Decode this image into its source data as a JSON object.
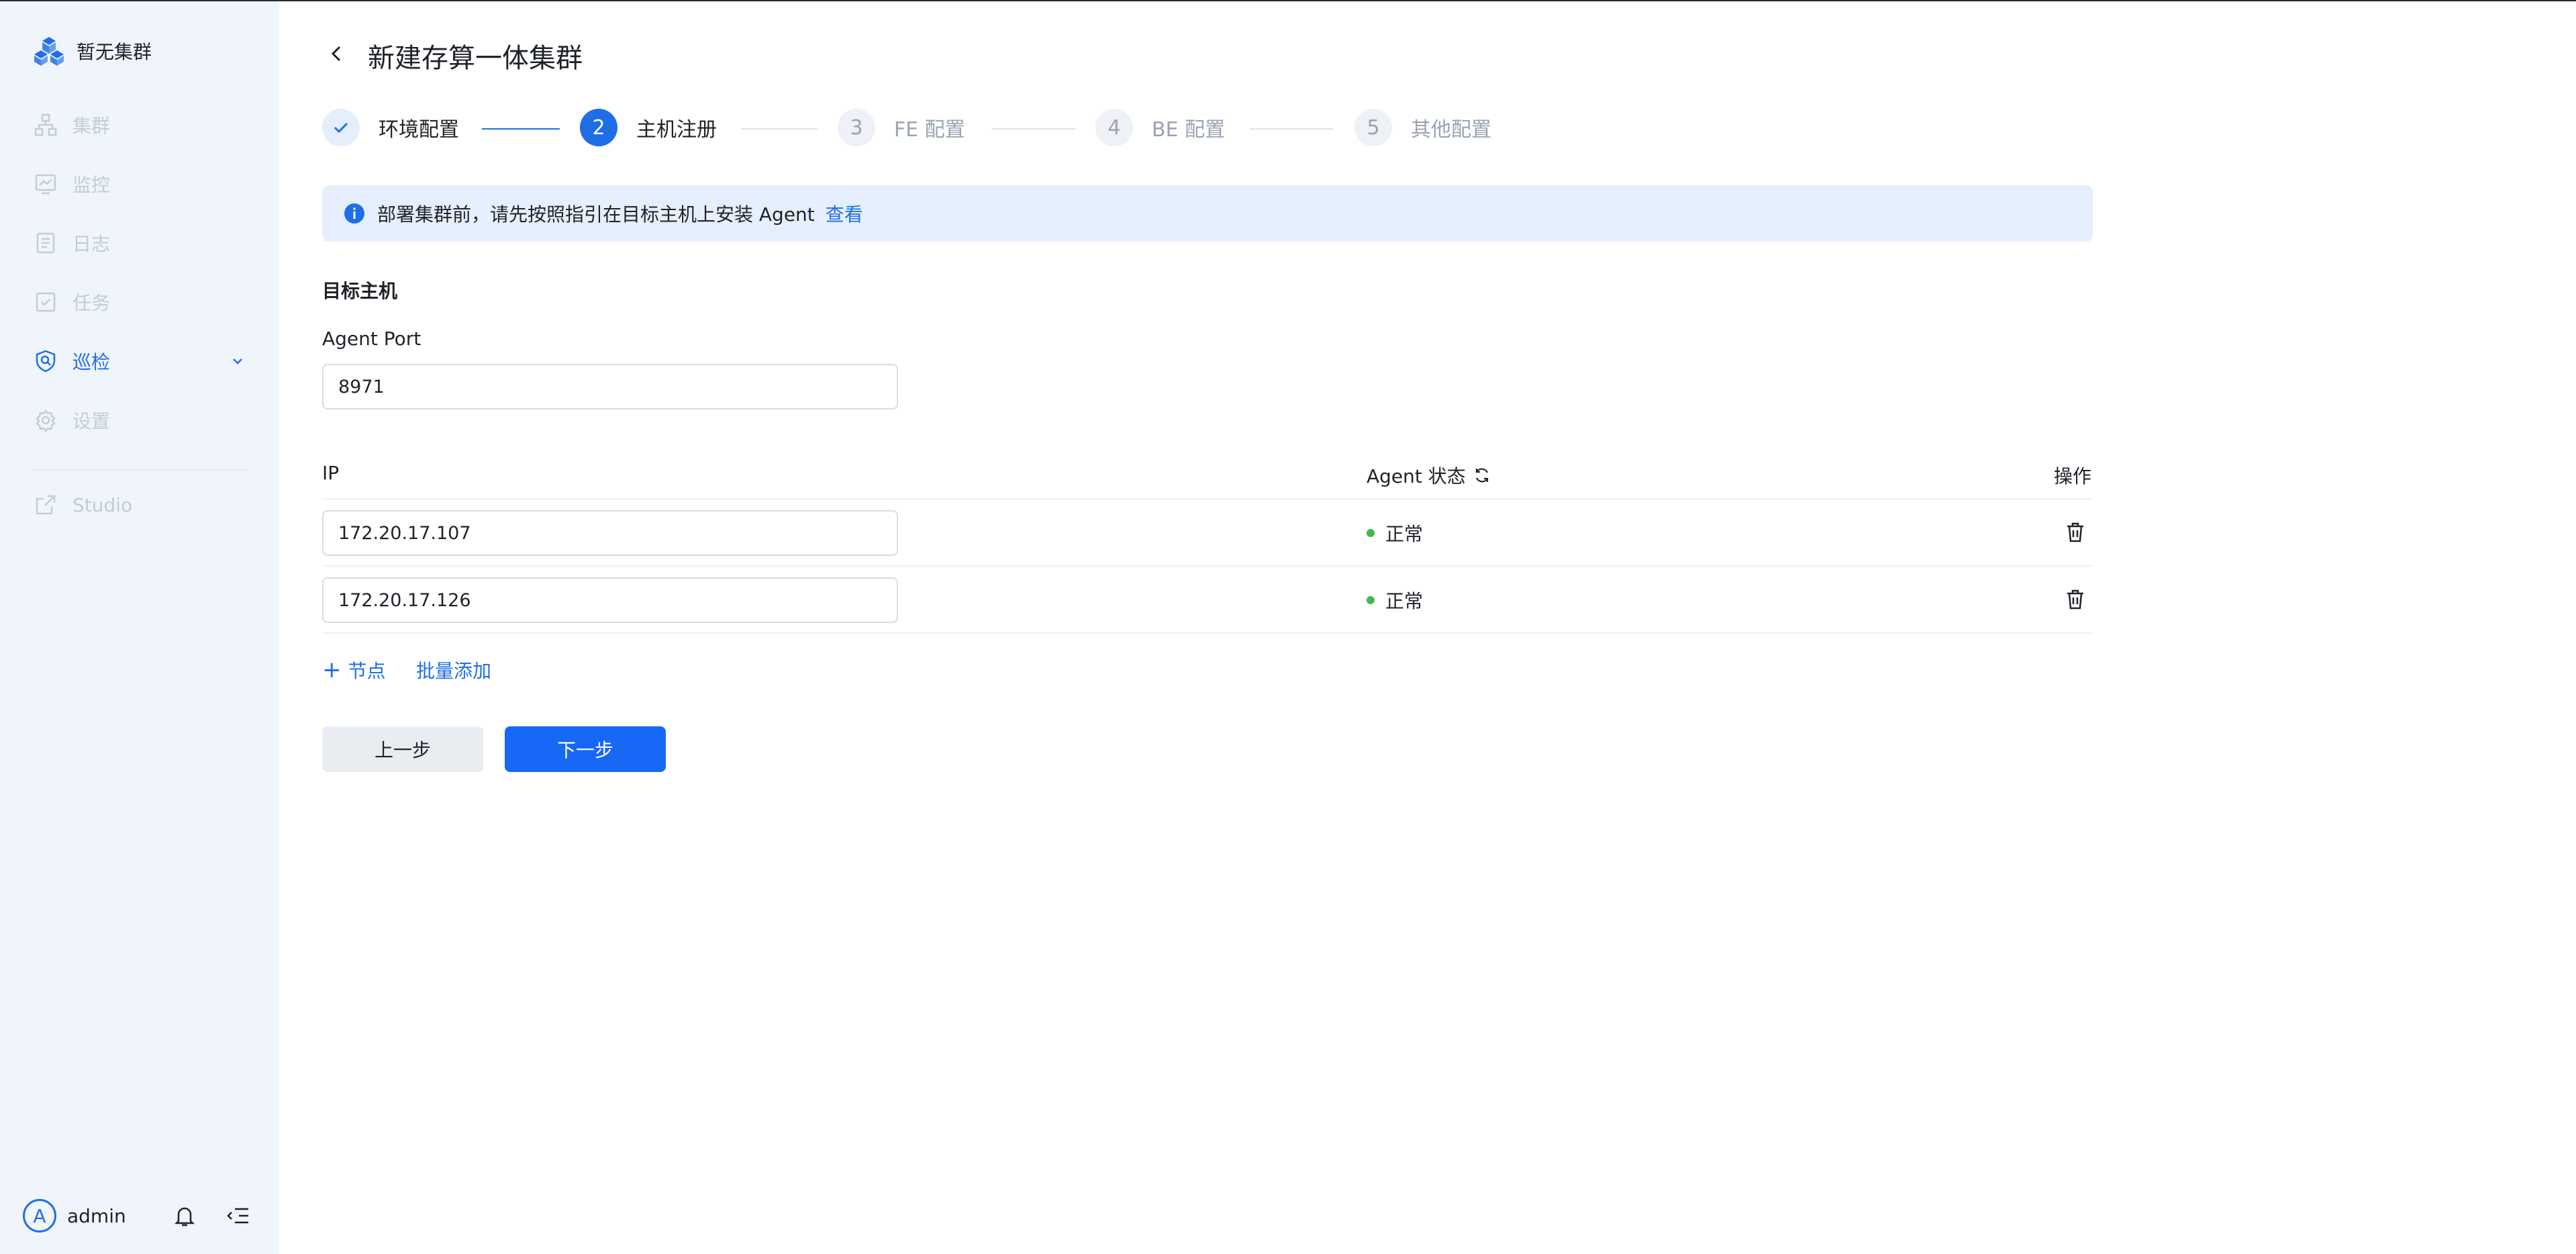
{
  "sidebar": {
    "brand": "暂无集群",
    "items": [
      {
        "label": "集群"
      },
      {
        "label": "监控"
      },
      {
        "label": "日志"
      },
      {
        "label": "任务"
      },
      {
        "label": "巡检"
      },
      {
        "label": "设置"
      },
      {
        "label": "Studio"
      }
    ],
    "user": {
      "avatar_letter": "A",
      "name": "admin"
    }
  },
  "page": {
    "title": "新建存算一体集群"
  },
  "steps": [
    {
      "number": "1",
      "label": "环境配置",
      "state": "done"
    },
    {
      "number": "2",
      "label": "主机注册",
      "state": "current"
    },
    {
      "number": "3",
      "label": "FE 配置",
      "state": "todo"
    },
    {
      "number": "4",
      "label": "BE 配置",
      "state": "todo"
    },
    {
      "number": "5",
      "label": "其他配置",
      "state": "todo"
    }
  ],
  "alert": {
    "text": "部署集群前，请先按照指引在目标主机上安装 Agent",
    "link": "查看"
  },
  "form": {
    "section_title": "目标主机",
    "port_label": "Agent Port",
    "port_value": "8971"
  },
  "table": {
    "headers": {
      "ip": "IP",
      "status": "Agent 状态",
      "action": "操作"
    },
    "rows": [
      {
        "ip": "172.20.17.107",
        "status": "正常"
      },
      {
        "ip": "172.20.17.126",
        "status": "正常"
      }
    ]
  },
  "actions": {
    "add_node": "节点",
    "add_node_plus": "+",
    "batch_add": "批量添加",
    "prev": "上一步",
    "next": "下一步"
  },
  "colors": {
    "accent": "#1f6ee8",
    "success": "#3fb950",
    "sidebar_bg": "#f0f5fc",
    "alert_bg": "#e5effd"
  }
}
